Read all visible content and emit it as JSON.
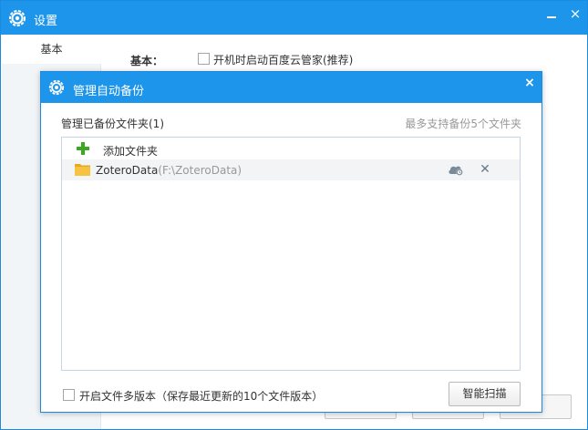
{
  "settings_window": {
    "title": "设置",
    "title_icon": "settings-gear-icon",
    "minimize_icon": "minimize-icon",
    "close_icon": "close-icon",
    "close_glyph": "×",
    "sidebar": {
      "items": [
        {
          "label": "基本",
          "active": true
        }
      ]
    },
    "basic_section": {
      "label": "基本：",
      "autostart_checkbox": {
        "label": "开机时启动百度云管家(推荐)",
        "checked": false
      }
    }
  },
  "backup_dialog": {
    "title": "管理自动备份",
    "title_icon": "settings-gear-icon",
    "close_glyph": "×",
    "heading": "管理已备份文件夹(1)",
    "limit_note": "最多支持备份5个文件夹",
    "add_folder": {
      "icon": "plus-icon",
      "label": "添加文件夹"
    },
    "folders": [
      {
        "name": "ZoteroData",
        "path": "(F:\\ZoteroData)",
        "icon": "folder-icon",
        "status_icon": "cloud-sync-icon",
        "remove_icon": "remove-icon",
        "remove_glyph": "✕"
      }
    ],
    "versions_checkbox": {
      "label": "开启文件多版本（保存最近更新的10个文件版本）",
      "checked": false
    },
    "scan_button": "智能扫描"
  },
  "colors": {
    "titlebar": "#1d95ea",
    "add_green": "#3aa820",
    "folder_yellow": "#f5c242",
    "border_blue": "#1a8be0"
  }
}
